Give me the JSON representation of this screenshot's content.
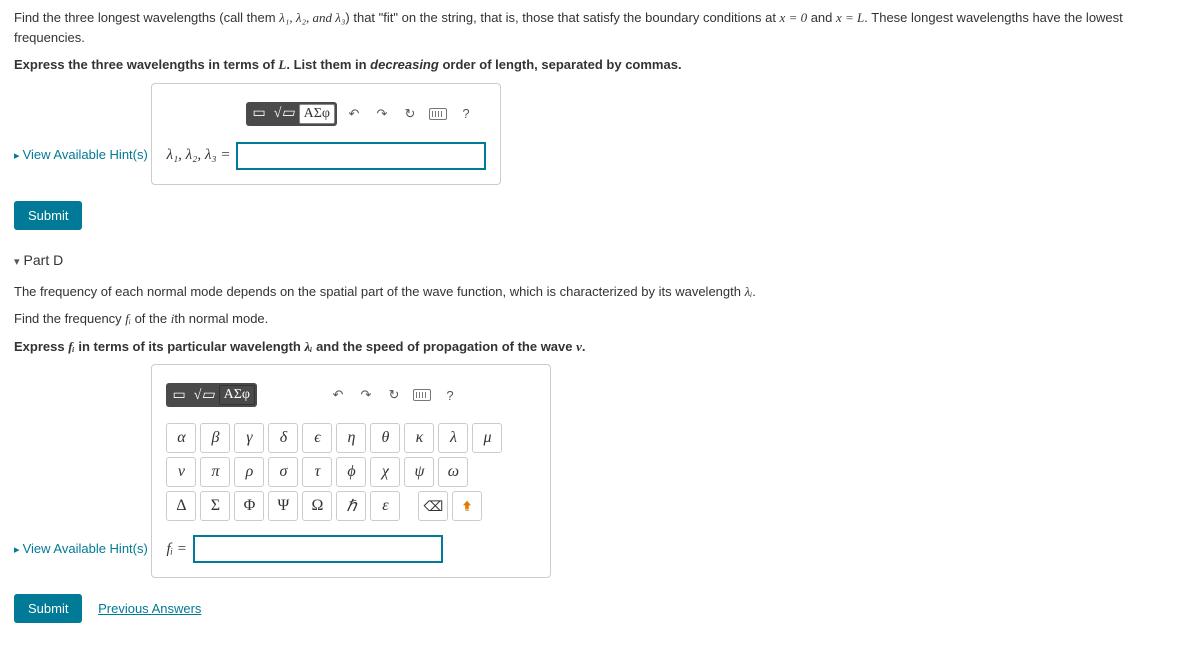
{
  "partC": {
    "prompt1a": "Find the three longest wavelengths (call them ",
    "prompt1b": ") that \"fit\" on the string, that is, those that satisfy the boundary conditions at ",
    "prompt1c": ". These longest wavelengths have the lowest frequencies.",
    "lambdas": "λ₁, λ₂, and λ₃",
    "xzero": "x = 0",
    "and": " and ",
    "xL": "x = L",
    "prompt2a": "Express the three wavelengths in terms of ",
    "L": "L",
    "prompt2b": ". List them in ",
    "decreasing": "decreasing",
    "prompt2c": " order of length, separated by commas.",
    "hint": "View Available Hint(s)",
    "asf": "ΑΣφ",
    "q": "?",
    "label": "λ₁, λ₂, λ₃ =",
    "submit": "Submit"
  },
  "partD": {
    "header": "Part D",
    "p1a": "The frequency of each normal mode depends on the spatial part of the wave function, which is characterized by its wavelength ",
    "p1b": "λᵢ",
    "p1c": ".",
    "p2a": "Find the frequency ",
    "p2b": "fᵢ",
    "p2c": " of the ",
    "p2d": "i",
    "p2e": "th normal mode.",
    "p3a": "Express ",
    "p3b": "fᵢ",
    "p3c": " in terms of its particular wavelength ",
    "p3d": "λᵢ",
    "p3e": " and the speed of propagation of the wave ",
    "p3f": "v",
    "p3g": ".",
    "hint": "View Available Hint(s)",
    "asf": "ΑΣφ",
    "q": "?",
    "label": "fᵢ =",
    "submit": "Submit",
    "prev": "Previous Answers"
  },
  "greek": {
    "r1": [
      "α",
      "β",
      "γ",
      "δ",
      "ϵ",
      "η",
      "θ",
      "κ",
      "λ",
      "μ"
    ],
    "r2": [
      "ν",
      "π",
      "ρ",
      "σ",
      "τ",
      "ϕ",
      "χ",
      "ψ",
      "ω"
    ],
    "r3": [
      "Δ",
      "Σ",
      "Φ",
      "Ψ",
      "Ω",
      "ℏ",
      "ε"
    ]
  }
}
